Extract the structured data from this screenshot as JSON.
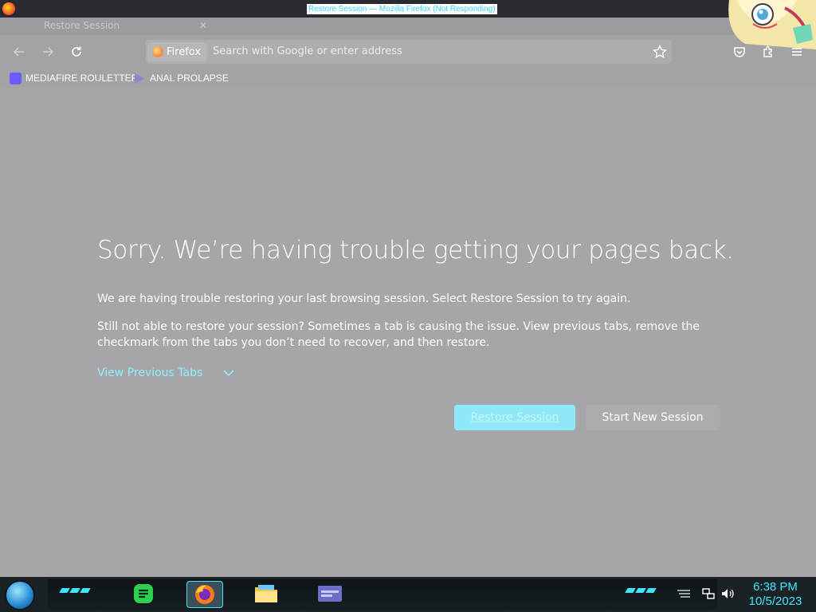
{
  "window": {
    "title": "Restore Session — Mozilla Firefox (Not Responding)",
    "tab_title": "Restore Session"
  },
  "toolbar": {
    "back_icon": "back-arrow-icon",
    "forward_icon": "forward-arrow-icon",
    "reload_icon": "reload-icon",
    "identity_label": "Firefox",
    "url_placeholder": "Search with Google or enter address",
    "url_value": ""
  },
  "bookmarks": [
    {
      "label": "MEDIAFIRE ROULETTER",
      "icon": "mediafire-icon"
    },
    {
      "label": "ANAL PROLAPSE",
      "icon": "bookmark-triangle-icon"
    }
  ],
  "content": {
    "heading": "Sorry. We’re having trouble getting your pages back.",
    "paragraph1": "We are having trouble restoring your last browsing session. Select Restore Session to try again.",
    "paragraph2": "Still not able to restore your session? Sometimes a tab is causing the issue. View previous tabs, remove the checkmark from the tabs you don’t need to recover, and then restore.",
    "view_previous_tabs": "View Previous Tabs",
    "restore_button": "Restore Session",
    "new_session_button": "Start New Session"
  },
  "taskbar": {
    "time": "6:38 PM",
    "date": "10/5/2023"
  },
  "colors": {
    "accent": "#3fe6ff",
    "link": "#8ef0ff",
    "restore_button_bg": "#8ee8f8",
    "overlay": "#a6a6a8"
  }
}
